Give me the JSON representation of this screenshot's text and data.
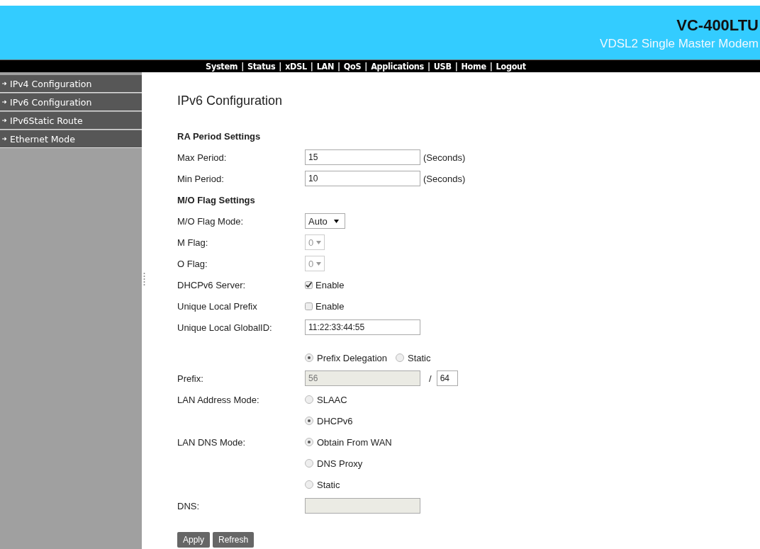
{
  "header": {
    "model": "VC-400LTU",
    "subtitle": "VDSL2 Single Master Modem"
  },
  "nav": {
    "separator": "|",
    "items": [
      "System",
      "Status",
      "xDSL",
      "LAN",
      "QoS",
      "Applications",
      "USB",
      "Home",
      "Logout"
    ]
  },
  "sidebar": {
    "items": [
      {
        "label": "IPv4 Configuration"
      },
      {
        "label": "IPv6 Configuration"
      },
      {
        "label": "IPv6Static Route"
      },
      {
        "label": "Ethernet Mode"
      }
    ]
  },
  "page_title": "IPv6 Configuration",
  "rows": [
    {
      "kind": "heading",
      "text": "RA Period Settings"
    },
    {
      "kind": "field",
      "label": "Max Period:",
      "value": "15",
      "unit": "(Seconds)",
      "disabled": false
    },
    {
      "kind": "field",
      "label": "Min Period:",
      "value": "10",
      "unit": "(Seconds)",
      "disabled": false
    },
    {
      "kind": "heading",
      "text": "M/O Flag Settings"
    },
    {
      "kind": "select",
      "label": "M/O Flag Mode:",
      "value": "Auto",
      "disabled": false
    },
    {
      "kind": "select",
      "label": "M Flag:",
      "value": "0",
      "disabled": true
    },
    {
      "kind": "select",
      "label": "O Flag:",
      "value": "0",
      "disabled": true
    },
    {
      "kind": "checkbox",
      "label": "DHCPv6 Server:",
      "text": "Enable",
      "checked": true
    },
    {
      "kind": "checkbox",
      "label": "Unique Local Prefix",
      "text": "Enable",
      "checked": false
    },
    {
      "kind": "field",
      "label": "Unique Local GlobalID:",
      "value": "11:22:33:44:55",
      "disabled": false
    },
    {
      "kind": "radios",
      "options": [
        {
          "text": "Prefix Delegation",
          "selected": true
        },
        {
          "text": "Static",
          "selected": false
        }
      ]
    },
    {
      "kind": "prefix",
      "label": "Prefix:",
      "value": "56",
      "disabled": true,
      "separator": "/",
      "length": "64"
    },
    {
      "kind": "radio-stack",
      "label": "LAN Address Mode:",
      "options": [
        {
          "text": "SLAAC",
          "selected": false
        },
        {
          "text": "DHCPv6",
          "selected": true
        }
      ]
    },
    {
      "kind": "radio-stack",
      "label": "LAN DNS Mode:",
      "options": [
        {
          "text": "Obtain From WAN",
          "selected": true
        },
        {
          "text": "DNS Proxy",
          "selected": false
        },
        {
          "text": "Static",
          "selected": false
        }
      ]
    },
    {
      "kind": "field",
      "label": "DNS:",
      "disabled": true
    }
  ],
  "buttons": [
    "Apply",
    "Refresh"
  ]
}
